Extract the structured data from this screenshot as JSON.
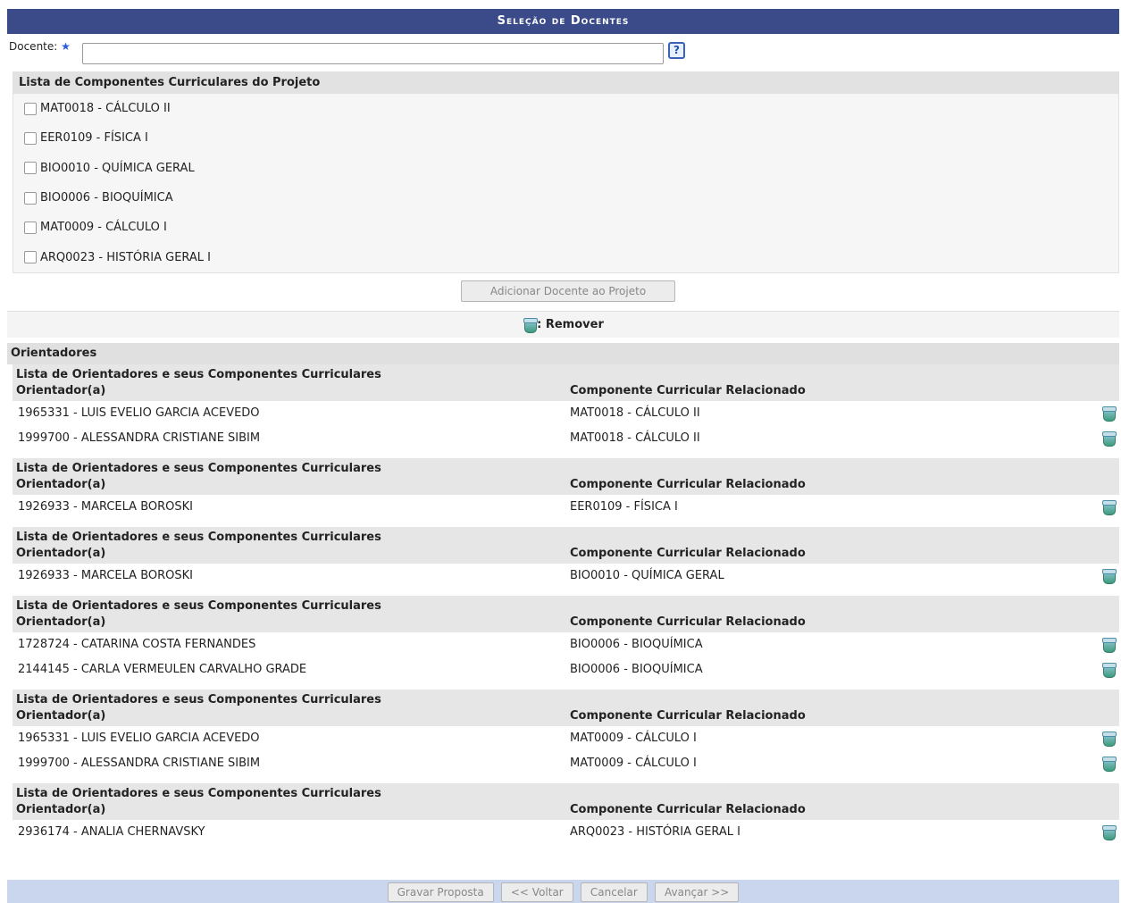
{
  "caption": "Seleção de Docentes",
  "docente": {
    "label": "Docente:",
    "required_mark": "★",
    "value": "",
    "help": "?"
  },
  "componentes": {
    "title": "Lista de Componentes Curriculares do Projeto",
    "items": [
      "MAT0018 - CÁLCULO II",
      "EER0109 - FÍSICA I",
      "BIO0010 - QUÍMICA GERAL",
      "BIO0006 - BIOQUÍMICA",
      "MAT0009 - CÁLCULO I",
      "ARQ0023 - HISTÓRIA GERAL I"
    ]
  },
  "add_button": "Adicionar Docente ao Projeto",
  "legend": {
    "remove_label": ": Remover",
    "icon": "trash-icon"
  },
  "orientadores": {
    "title": "Orientadores",
    "group_title": "Lista de Orientadores e seus Componentes Curriculares",
    "col_orientador": "Orientador(a)",
    "col_componente": "Componente Curricular Relacionado",
    "groups": [
      {
        "rows": [
          {
            "orientador": "1965331 - LUIS EVELIO GARCIA ACEVEDO",
            "componente": "MAT0018 - CÁLCULO II"
          },
          {
            "orientador": "1999700 - ALESSANDRA CRISTIANE SIBIM",
            "componente": "MAT0018 - CÁLCULO II"
          }
        ]
      },
      {
        "rows": [
          {
            "orientador": "1926933 - MARCELA BOROSKI",
            "componente": "EER0109 - FÍSICA I"
          }
        ]
      },
      {
        "rows": [
          {
            "orientador": "1926933 - MARCELA BOROSKI",
            "componente": "BIO0010 - QUÍMICA GERAL"
          }
        ]
      },
      {
        "rows": [
          {
            "orientador": "1728724 - CATARINA COSTA FERNANDES",
            "componente": "BIO0006 - BIOQUÍMICA"
          },
          {
            "orientador": "2144145 - CARLA VERMEULEN CARVALHO GRADE",
            "componente": "BIO0006 - BIOQUÍMICA"
          }
        ]
      },
      {
        "rows": [
          {
            "orientador": "1965331 - LUIS EVELIO GARCIA ACEVEDO",
            "componente": "MAT0009 - CÁLCULO I"
          },
          {
            "orientador": "1999700 - ALESSANDRA CRISTIANE SIBIM",
            "componente": "MAT0009 - CÁLCULO I"
          }
        ]
      },
      {
        "rows": [
          {
            "orientador": "2936174 - ANALIA CHERNAVSKY",
            "componente": "ARQ0023 - HISTÓRIA GERAL I"
          }
        ]
      }
    ]
  },
  "footer": {
    "gravar": "Gravar Proposta",
    "voltar": "<< Voltar",
    "cancelar": "Cancelar",
    "avancar": "Avançar >>"
  }
}
